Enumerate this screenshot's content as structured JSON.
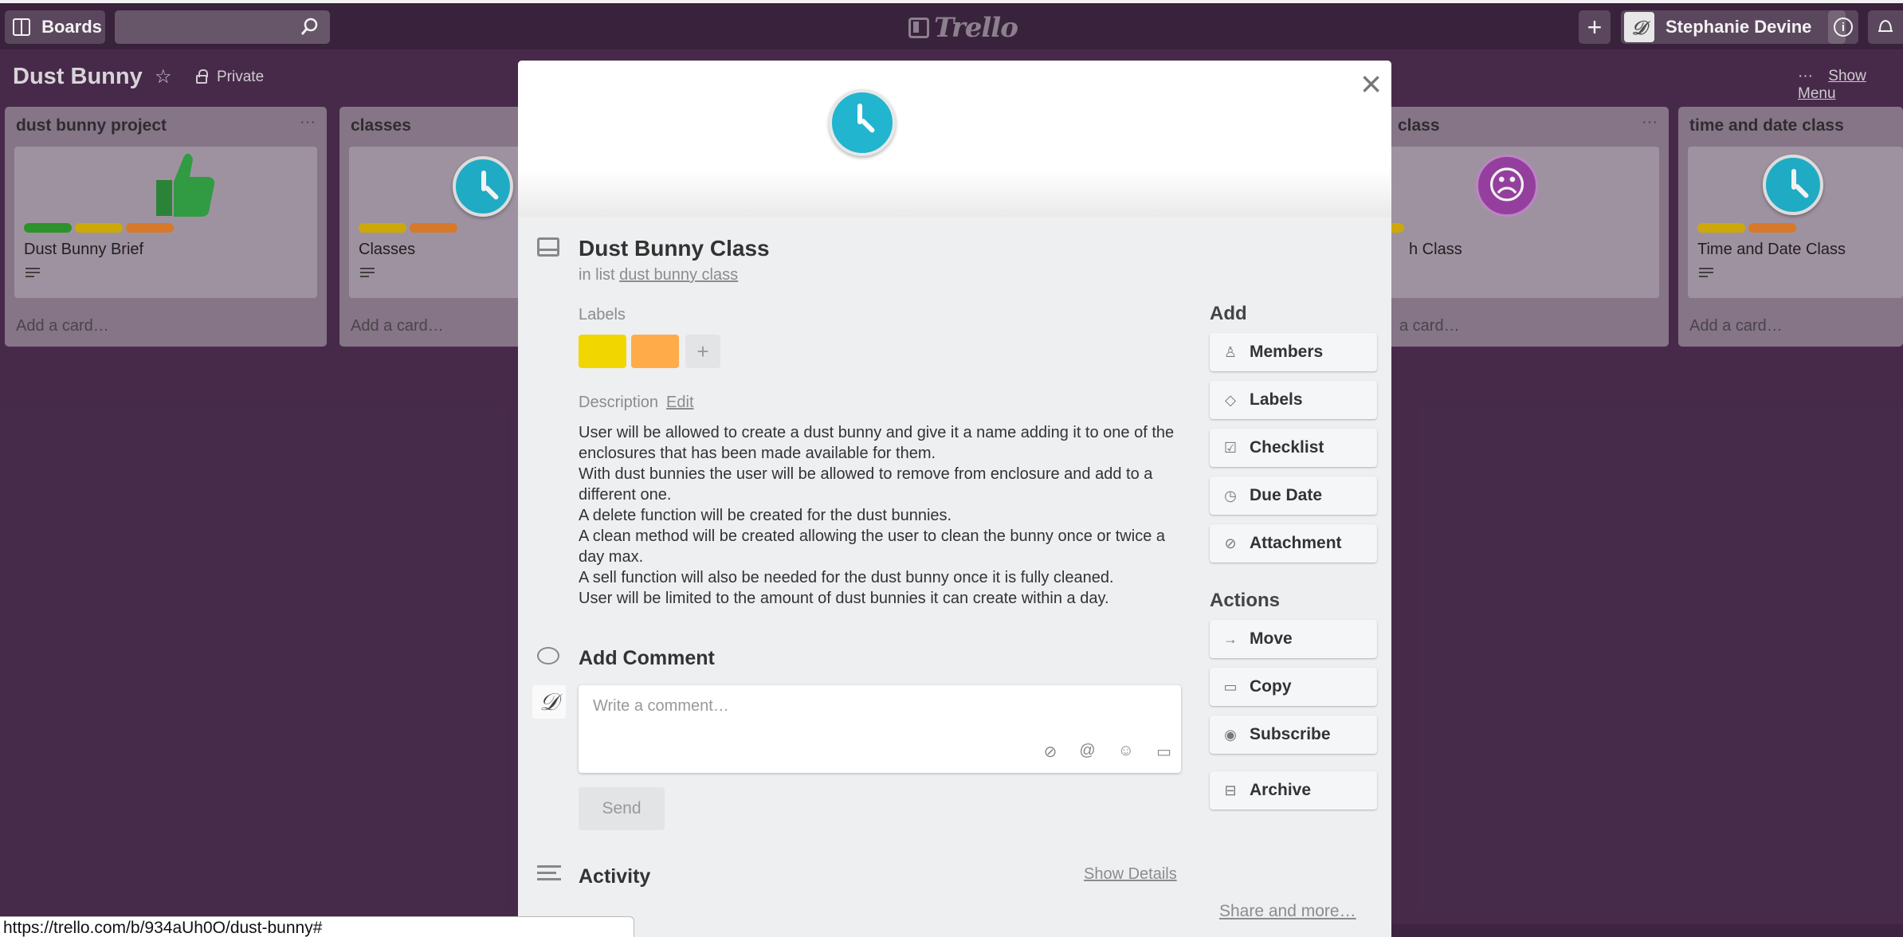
{
  "header": {
    "boards_label": "Boards",
    "search_placeholder": "",
    "logo_text": "Trello",
    "add_label": "+",
    "user_name": "Stephanie Devine",
    "info_label": "i"
  },
  "board": {
    "title": "Dust Bunny",
    "visibility": "Private",
    "menu_dots": "···",
    "show_menu": "Show Menu"
  },
  "lists": [
    {
      "title": "dust bunny project",
      "menu": "···",
      "card_title": "Dust Bunny Brief",
      "add_card": "Add a card…",
      "label_colors": [
        "#2f9a2f",
        "#d9b10b",
        "#e2802d"
      ]
    },
    {
      "title": "classes",
      "menu": "",
      "card_title": "Classes",
      "add_card": "Add a card…",
      "label_colors": [
        "#d9b10b",
        "#e2802d"
      ]
    },
    {
      "title": "class",
      "menu": "···",
      "card_title": "h Class",
      "add_card": "a card…",
      "label_colors": [
        "#d9b10b"
      ]
    },
    {
      "title": "time and date class",
      "menu": "",
      "card_title": "Time and Date Class",
      "add_card": "Add a card…",
      "label_colors": [
        "#d9b10b",
        "#e2802d"
      ]
    }
  ],
  "modal": {
    "close": "×",
    "title": "Dust Bunny Class",
    "in_list_prefix": "in list",
    "in_list_link": "dust bunny class",
    "labels_heading": "Labels",
    "label_colors": [
      "#f2d600",
      "#ffab4a"
    ],
    "label_add": "+",
    "description_heading": "Description",
    "description_edit": "Edit",
    "description_lines": [
      "User will be allowed to create a dust bunny and give it a name adding it to one of the enclosures that has been made available for them.",
      "With dust bunnies the user will be allowed to remove from enclosure and add to a different one.",
      "A delete function will be created for the dust bunnies.",
      "A clean method will be created allowing the user to clean the bunny once or twice a day max.",
      "A sell function will also be needed for the dust bunny once it is fully cleaned.",
      "User will be limited to the amount of dust bunnies it can create within a day."
    ],
    "add_comment_heading": "Add Comment",
    "comment_placeholder": "Write a comment…",
    "send_label": "Send",
    "activity_heading": "Activity",
    "show_details": "Show Details",
    "add_heading": "Add",
    "add_buttons": [
      "Members",
      "Labels",
      "Checklist",
      "Due Date",
      "Attachment"
    ],
    "actions_heading": "Actions",
    "action_buttons": [
      "Move",
      "Copy",
      "Subscribe",
      "Archive"
    ],
    "share_more": "Share and more…"
  },
  "status_bar": {
    "url": "https://trello.com/b/934aUh0O/dust-bunny#"
  },
  "colors": {
    "board_bg": "#4b2d4f",
    "header_bg": "#3d2440",
    "modal_bg": "#edeff0",
    "clock_badge": "#22b5cf"
  }
}
